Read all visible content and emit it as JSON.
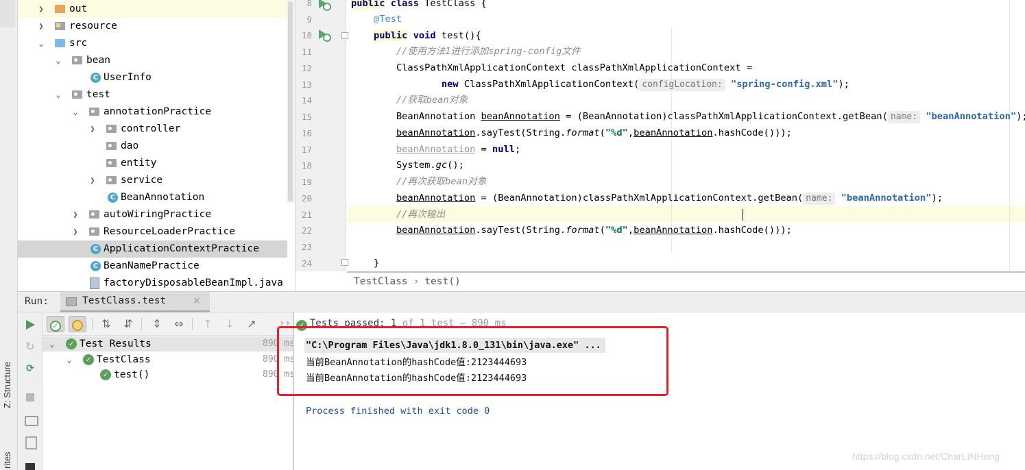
{
  "left_strip": {
    "structure_label": "Z: Structure",
    "favorites_label": "rites"
  },
  "project_tree": {
    "items": [
      {
        "label": "out",
        "icon": "folder-orange",
        "arrow": "right"
      },
      {
        "label": "resource",
        "icon": "resource-folder",
        "arrow": "right"
      },
      {
        "label": "src",
        "icon": "folder-blue",
        "arrow": "down"
      },
      {
        "label": "bean",
        "icon": "package",
        "arrow": "down"
      },
      {
        "label": "UserInfo",
        "icon": "class"
      },
      {
        "label": "test",
        "icon": "package",
        "arrow": "down"
      },
      {
        "label": "annotationPractice",
        "icon": "package",
        "arrow": "down"
      },
      {
        "label": "controller",
        "icon": "package",
        "arrow": "right"
      },
      {
        "label": "dao",
        "icon": "package"
      },
      {
        "label": "entity",
        "icon": "package"
      },
      {
        "label": "service",
        "icon": "package",
        "arrow": "right"
      },
      {
        "label": "BeanAnnotation",
        "icon": "class"
      },
      {
        "label": "autoWiringPractice",
        "icon": "package",
        "arrow": "right"
      },
      {
        "label": "ResourceLoaderPractice",
        "icon": "package",
        "arrow": "right"
      },
      {
        "label": "ApplicationContextPractice",
        "icon": "class",
        "selected": true
      },
      {
        "label": "BeanNamePractice",
        "icon": "class"
      },
      {
        "label": "factoryDisposableBeanImpl.java",
        "icon": "java-file"
      }
    ]
  },
  "editor": {
    "line_numbers": [
      "8",
      "9",
      "10",
      "11",
      "12",
      "13",
      "14",
      "15",
      "16",
      "17",
      "18",
      "19",
      "20",
      "21",
      "22",
      "23",
      "24"
    ],
    "code": {
      "l8_kw1": "public",
      "l8_kw2": "class",
      "l8_rest": " TestClass {",
      "l9_ann": "@Test",
      "l10_kw1": "public",
      "l10_kw2": "void",
      "l10_rest": " test(){",
      "l11_comment": "//使用方法1进行添加spring-config文件",
      "l12_text": "ClassPathXmlApplicationContext classPathXmlApplicationContext =",
      "l13_kw": "new",
      "l13_text": " ClassPathXmlApplicationContext(",
      "l13_hint": "configLocation:",
      "l13_str": "\"spring-config.xml\"",
      "l13_end": ");",
      "l14_comment": "//获取bean对象",
      "l15_a": "BeanAnnotation ",
      "l15_var": "beanAnnotation",
      "l15_b": " = (BeanAnnotation)classPathXmlApplicationContext.getBean(",
      "l15_hint": "name:",
      "l15_str": "\"beanAnnotation\"",
      "l15_end": ");",
      "l16_var": "beanAnnotation",
      "l16_a": ".sayTest(String.",
      "l16_fmt": "format",
      "l16_b": "(",
      "l16_str": "\"%d\"",
      "l16_c": ",",
      "l16_var2": "beanAnnotation",
      "l16_d": ".hashCode()));",
      "l17_var": "beanAnnotation",
      "l17_a": " = ",
      "l17_kw": "null",
      "l17_b": ";",
      "l18_a": "System.",
      "l18_gc": "gc",
      "l18_b": "();",
      "l19_comment": "//再次获取bean对象",
      "l20_var": "beanAnnotation",
      "l20_a": " = (BeanAnnotation)classPathXmlApplicationContext.getBean(",
      "l20_hint": "name:",
      "l20_str": "\"beanAnnotation\"",
      "l20_end": ");",
      "l21_comment": "//再次输出",
      "l22_var": "beanAnnotation",
      "l22_a": ".sayTest(String.",
      "l22_fmt": "format",
      "l22_b": "(",
      "l22_str": "\"%d\"",
      "l22_c": ",",
      "l22_var2": "beanAnnotation",
      "l22_d": ".hashCode()));",
      "l24_text": "}"
    },
    "breadcrumb": {
      "class": "TestClass",
      "separator": "›",
      "method": "test()"
    }
  },
  "run": {
    "label": "Run:",
    "tab_label": "TestClass.test",
    "tab_close": "×",
    "status_more": "››",
    "status_passed": "Tests passed: 1",
    "status_rest": "of 1 test – 890 ms",
    "test_tree": [
      {
        "label": "Test Results",
        "time": "890 ms",
        "arrow": "down"
      },
      {
        "label": "TestClass",
        "time": "890 ms",
        "arrow": "down"
      },
      {
        "label": "test()",
        "time": "890 ms"
      }
    ],
    "console": {
      "cmd": "\"C:\\Program Files\\Java\\jdk1.8.0_131\\bin\\java.exe\" ...",
      "output1": "当前BeanAnnotation的hashCode值:2123444693",
      "output2": "当前BeanAnnotation的hashCode值:2123444693",
      "process": "Process finished with exit code 0"
    }
  },
  "watermark": "https://blog.csdn.net/CharLINHeng",
  "colors": {
    "keyword": "#000080",
    "annotation": "#3a8fd8",
    "comment": "#8c8c8c",
    "string": "#0a7a3a",
    "pass_green": "#5aa05a",
    "highlight_box": "#e8202a"
  }
}
